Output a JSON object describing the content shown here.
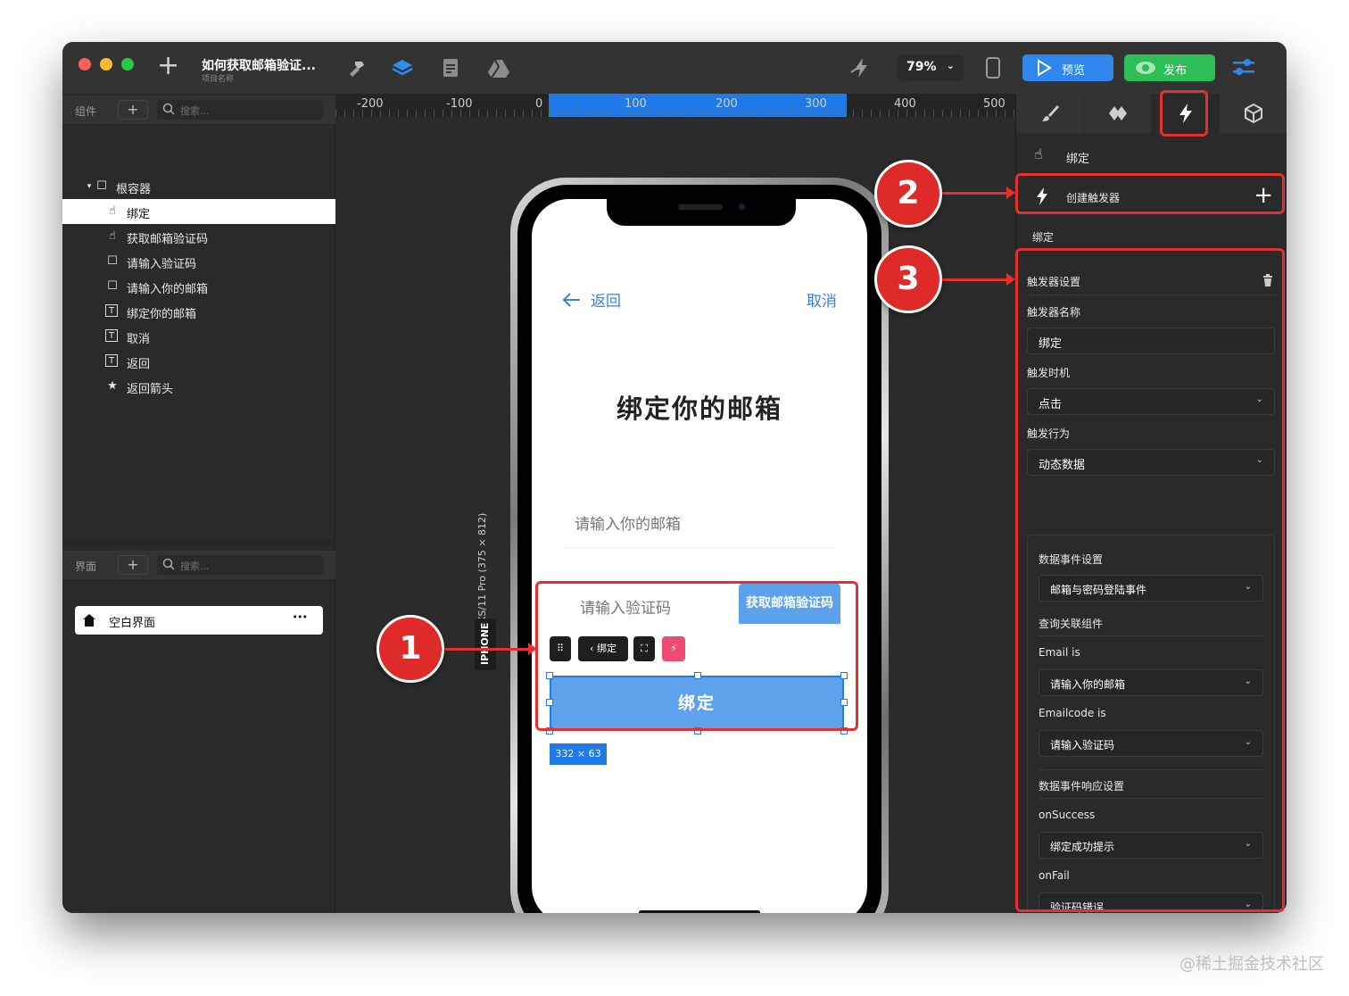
{
  "titlebar": {
    "project_title": "如何获取邮箱验证...",
    "project_subtitle": "项目名称",
    "zoom": "79%",
    "preview_label": "预览",
    "publish_label": "发布"
  },
  "left_panel": {
    "components_label": "组件",
    "search_placeholder": "搜索...",
    "tree": [
      {
        "label": "根容器",
        "icon": "square-icon"
      },
      {
        "label": "绑定",
        "icon": "hand-pointer-icon"
      },
      {
        "label": "获取邮箱验证码",
        "icon": "hand-pointer-icon"
      },
      {
        "label": "请输入验证码",
        "icon": "square-icon"
      },
      {
        "label": "请输入你的邮箱",
        "icon": "square-icon"
      },
      {
        "label": "绑定你的邮箱",
        "icon": "text-icon"
      },
      {
        "label": "取消",
        "icon": "text-icon"
      },
      {
        "label": "返回",
        "icon": "text-icon"
      },
      {
        "label": "返回箭头",
        "icon": "star-icon"
      }
    ],
    "pages_label": "界面",
    "pages_search_placeholder": "搜索...",
    "page_item": "空白界面",
    "page_more": "•••"
  },
  "canvas": {
    "ruler_labels": [
      "-200",
      "-100",
      "0",
      "100",
      "200",
      "300",
      "400",
      "500"
    ],
    "device_name": "iPhone X/XS/11 Pro (375 × 812)",
    "device_tag": "IPHONE",
    "screen": {
      "back": "返回",
      "cancel": "取消",
      "title": "绑定你的邮箱",
      "email_placeholder": "请输入你的邮箱",
      "code_placeholder": "请输入验证码",
      "get_code": "获取邮箱验证码",
      "bind_button": "绑定",
      "toolbar_bind": "绑定",
      "size_badge": "332 × 63"
    }
  },
  "right_panel": {
    "interaction_title": "绑定",
    "create_trigger": "创建触发器",
    "bound_label": "绑定",
    "trigger_settings": "触发器设置",
    "trigger_name_label": "触发器名称",
    "trigger_name_value": "绑定",
    "trigger_time_label": "触发时机",
    "trigger_time_value": "点击",
    "trigger_action_label": "触发行为",
    "trigger_action_value": "动态数据",
    "data_event_settings": "数据事件设置",
    "data_event_value": "邮箱与密码登陆事件",
    "query_components": "查询关联组件",
    "email_is": "Email is",
    "email_is_value": "请输入你的邮箱",
    "emailcode_is": "Emailcode is",
    "emailcode_is_value": "请输入验证码",
    "response_settings": "数据事件响应设置",
    "on_success": "onSuccess",
    "on_success_value": "绑定成功提示",
    "on_fail": "onFail",
    "on_fail_value": "验证码错误"
  },
  "annotations": {
    "one": "1",
    "two": "2",
    "three": "3"
  },
  "colors": {
    "accent_blue": "#2e86ee",
    "publish_green": "#2dbf56",
    "annotation_red": "#e53030",
    "bind_button": "#5ea2ec"
  },
  "watermark": "@稀土掘金技术社区"
}
